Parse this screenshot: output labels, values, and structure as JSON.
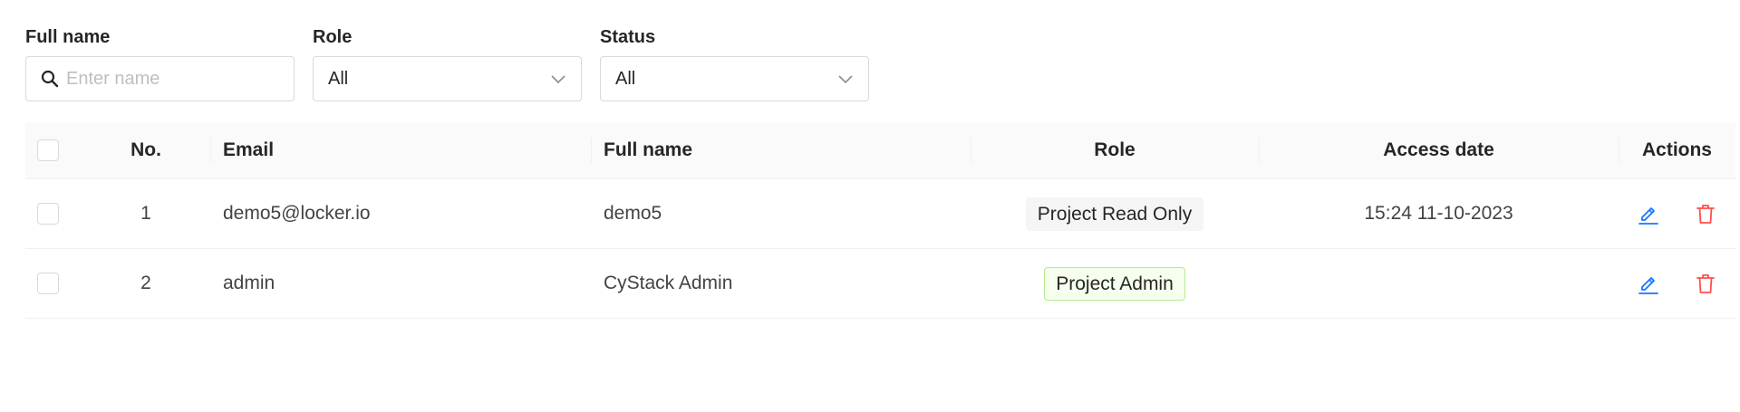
{
  "filters": {
    "full_name": {
      "label": "Full name",
      "placeholder": "Enter name",
      "value": ""
    },
    "role": {
      "label": "Role",
      "value": "All"
    },
    "status": {
      "label": "Status",
      "value": "All"
    }
  },
  "table": {
    "headers": {
      "no": "No.",
      "email": "Email",
      "full_name": "Full name",
      "role": "Role",
      "access_date": "Access date",
      "actions": "Actions"
    },
    "rows": [
      {
        "no": "1",
        "email": "demo5@locker.io",
        "full_name": "demo5",
        "role": "Project Read Only",
        "access_date": "15:24 11-10-2023"
      },
      {
        "no": "2",
        "email": "admin",
        "full_name": "CyStack Admin",
        "role": "Project Admin",
        "access_date": ""
      }
    ]
  },
  "colors": {
    "edit_icon": "#1677ff",
    "delete_icon": "#ff4d4f",
    "admin_tag_bg": "#f6ffed",
    "admin_tag_border": "#b7eb8f",
    "readonly_tag_bg": "#f5f5f5"
  },
  "icons": {
    "search": "search-icon",
    "dropdown": "chevron-down-icon",
    "edit": "edit-icon",
    "delete": "trash-icon"
  }
}
